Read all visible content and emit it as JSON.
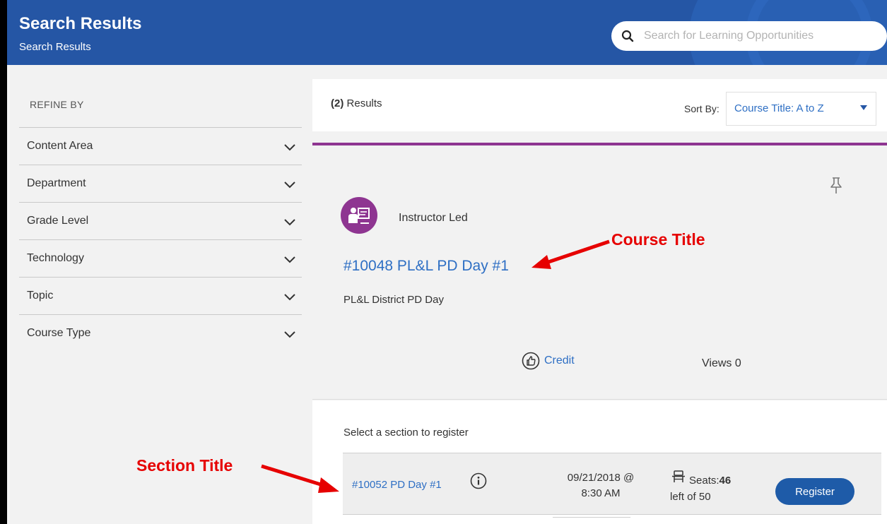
{
  "header": {
    "title": "Search Results",
    "subtitle": "Search Results",
    "search_placeholder": "Search for Learning Opportunities"
  },
  "sidebar": {
    "refine_label": "REFINE BY",
    "filters": [
      {
        "label": "Content Area"
      },
      {
        "label": "Department"
      },
      {
        "label": "Grade Level"
      },
      {
        "label": "Technology"
      },
      {
        "label": "Topic"
      },
      {
        "label": "Course Type"
      }
    ]
  },
  "results": {
    "count": "(2)",
    "count_label": "Results",
    "sort_label": "Sort By:",
    "sort_value": "Course Title: A to Z"
  },
  "course": {
    "type_label": "Instructor Led",
    "title": "#10048 PL&L PD Day #1",
    "description": "PL&L District PD Day",
    "credit_label": "Credit",
    "views_label": "Views 0"
  },
  "section_list": {
    "select_label": "Select a section to register",
    "sections": [
      {
        "title": "#10052 PD Day #1",
        "date": "09/21/2018 @",
        "time": "8:30 AM",
        "seats_label": "Seats:",
        "seats_left": "46",
        "seats_total": "left of 50",
        "register_label": "Register"
      }
    ]
  },
  "annotations": {
    "course_title": "Course Title",
    "section_title": "Section Title"
  },
  "colors": {
    "header": "#2556a5",
    "accent": "#8e3591",
    "link": "#2e6fc4",
    "annotation": "#e60000"
  }
}
